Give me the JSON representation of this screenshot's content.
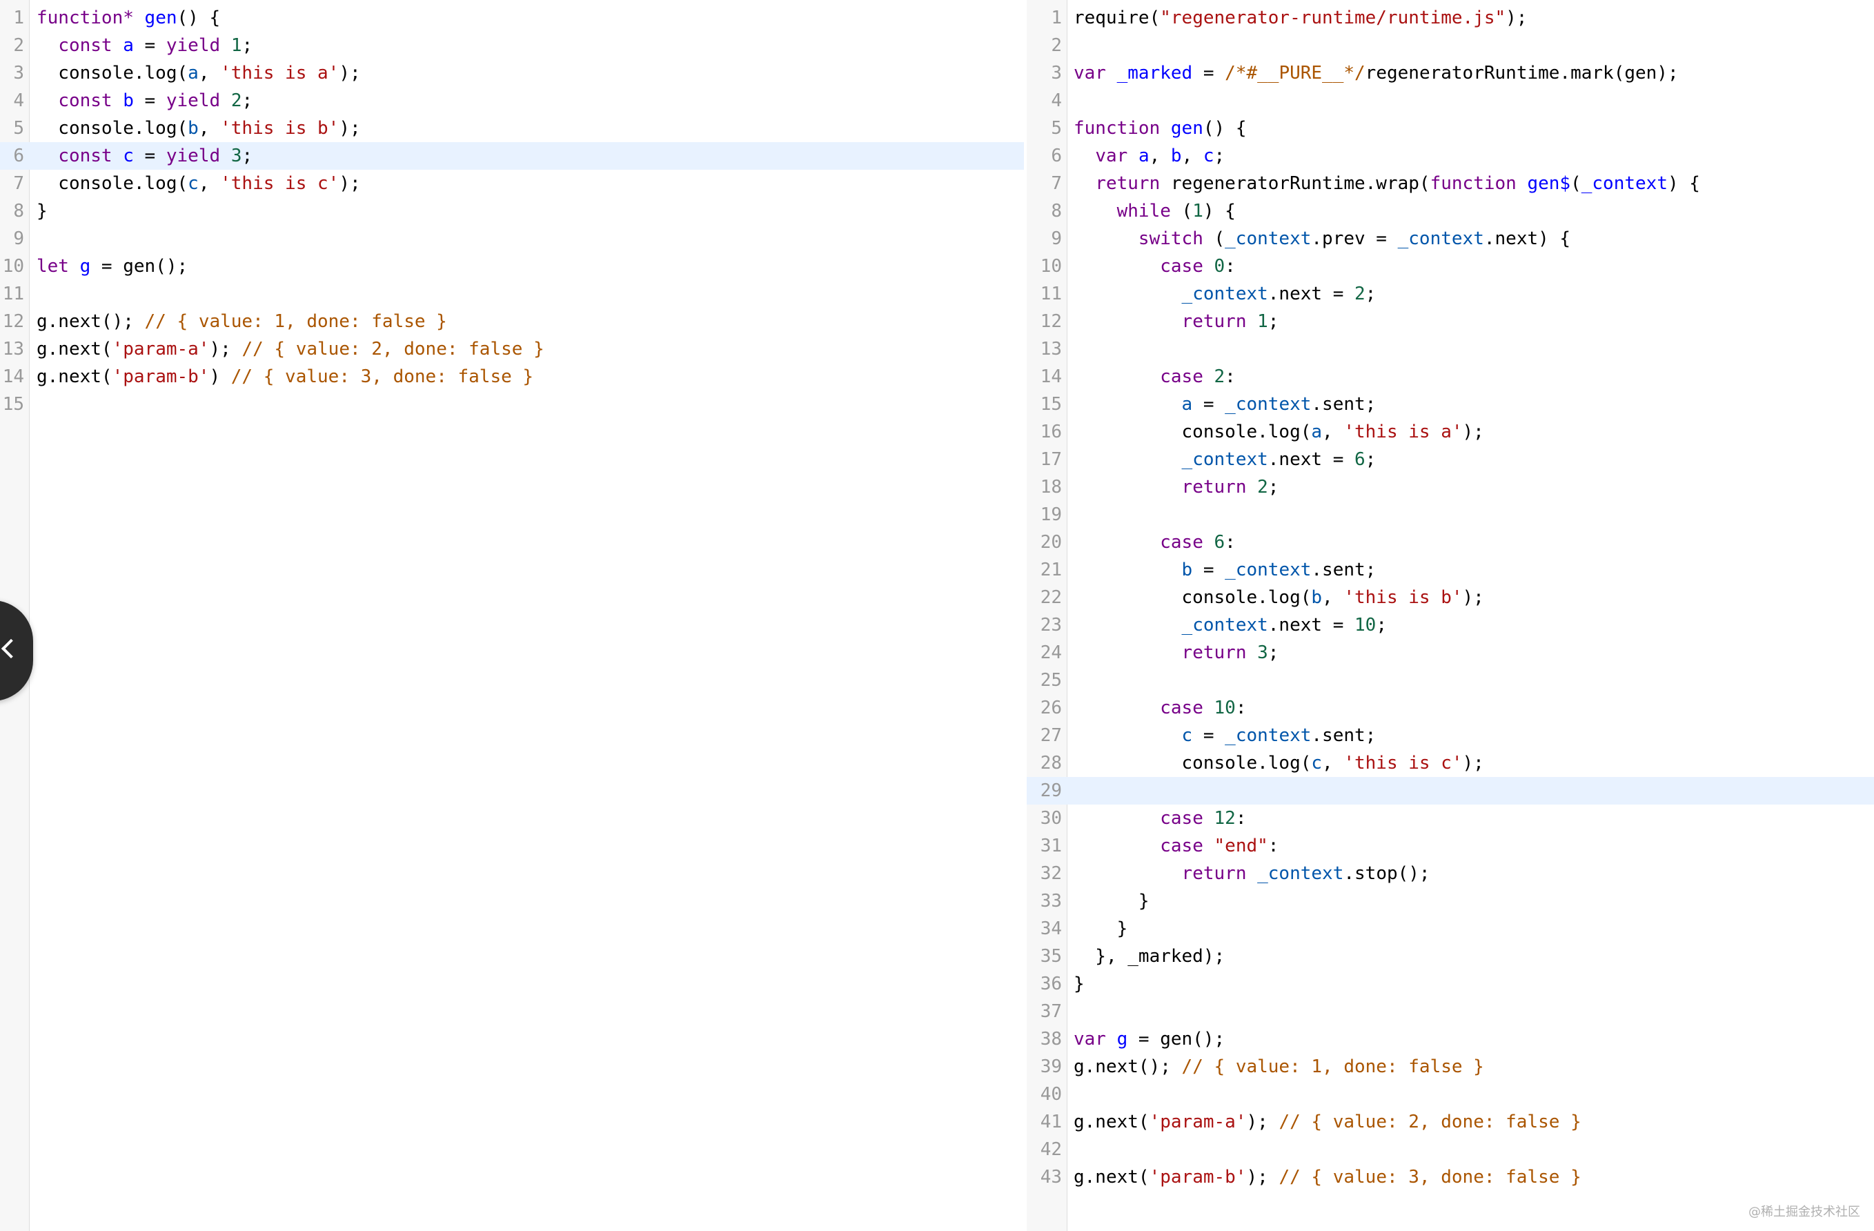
{
  "left_editor": {
    "active_line": 6,
    "lines": [
      [
        [
          "kw",
          "function"
        ],
        [
          "kw",
          "*"
        ],
        [
          "",
          " "
        ],
        [
          "def",
          "gen"
        ],
        [
          "",
          "() {"
        ]
      ],
      [
        [
          "",
          "  "
        ],
        [
          "kw",
          "const"
        ],
        [
          "",
          " "
        ],
        [
          "def",
          "a"
        ],
        [
          "",
          " = "
        ],
        [
          "kw",
          "yield"
        ],
        [
          "",
          " "
        ],
        [
          "num",
          "1"
        ],
        [
          "",
          ";"
        ]
      ],
      [
        [
          "",
          "  console.log("
        ],
        [
          "var",
          "a"
        ],
        [
          "",
          ", "
        ],
        [
          "str",
          "'this is a'"
        ],
        [
          "",
          ");"
        ]
      ],
      [
        [
          "",
          "  "
        ],
        [
          "kw",
          "const"
        ],
        [
          "",
          " "
        ],
        [
          "def",
          "b"
        ],
        [
          "",
          " = "
        ],
        [
          "kw",
          "yield"
        ],
        [
          "",
          " "
        ],
        [
          "num",
          "2"
        ],
        [
          "",
          ";"
        ]
      ],
      [
        [
          "",
          "  console.log("
        ],
        [
          "var",
          "b"
        ],
        [
          "",
          ", "
        ],
        [
          "str",
          "'this is b'"
        ],
        [
          "",
          ");"
        ]
      ],
      [
        [
          "",
          "  "
        ],
        [
          "kw",
          "const"
        ],
        [
          "",
          " "
        ],
        [
          "def",
          "c"
        ],
        [
          "",
          " = "
        ],
        [
          "kw",
          "yield"
        ],
        [
          "",
          " "
        ],
        [
          "num",
          "3"
        ],
        [
          "",
          ";"
        ]
      ],
      [
        [
          "",
          "  console.log("
        ],
        [
          "var",
          "c"
        ],
        [
          "",
          ", "
        ],
        [
          "str",
          "'this is c'"
        ],
        [
          "",
          ");"
        ]
      ],
      [
        [
          "",
          "}"
        ]
      ],
      [],
      [
        [
          "kw",
          "let"
        ],
        [
          "",
          " "
        ],
        [
          "def",
          "g"
        ],
        [
          "",
          " = gen();"
        ]
      ],
      [],
      [
        [
          "",
          "g.next(); "
        ],
        [
          "com",
          "// { value: 1, done: false }"
        ]
      ],
      [
        [
          "",
          "g.next("
        ],
        [
          "str",
          "'param-a'"
        ],
        [
          "",
          "); "
        ],
        [
          "com",
          "// { value: 2, done: false }"
        ]
      ],
      [
        [
          "",
          "g.next("
        ],
        [
          "str",
          "'param-b'"
        ],
        [
          "",
          ") "
        ],
        [
          "com",
          "// { value: 3, done: false }"
        ]
      ],
      []
    ]
  },
  "right_editor": {
    "active_line": 29,
    "lines": [
      [
        [
          "",
          "require("
        ],
        [
          "str",
          "\"regenerator-runtime/runtime.js\""
        ],
        [
          "",
          ");"
        ]
      ],
      [],
      [
        [
          "kw",
          "var"
        ],
        [
          "",
          " "
        ],
        [
          "def",
          "_marked"
        ],
        [
          "",
          " = "
        ],
        [
          "com",
          "/*#__PURE__*/"
        ],
        [
          "",
          "regeneratorRuntime.mark(gen);"
        ]
      ],
      [],
      [
        [
          "kw",
          "function"
        ],
        [
          "",
          " "
        ],
        [
          "def",
          "gen"
        ],
        [
          "",
          "() {"
        ]
      ],
      [
        [
          "",
          "  "
        ],
        [
          "kw",
          "var"
        ],
        [
          "",
          " "
        ],
        [
          "def",
          "a"
        ],
        [
          "",
          ", "
        ],
        [
          "def",
          "b"
        ],
        [
          "",
          ", "
        ],
        [
          "def",
          "c"
        ],
        [
          "",
          ";"
        ]
      ],
      [
        [
          "",
          "  "
        ],
        [
          "kw",
          "return"
        ],
        [
          "",
          " regeneratorRuntime.wrap("
        ],
        [
          "kw",
          "function"
        ],
        [
          "",
          " "
        ],
        [
          "def",
          "gen$"
        ],
        [
          "",
          "("
        ],
        [
          "def",
          "_context"
        ],
        [
          "",
          ") {"
        ]
      ],
      [
        [
          "",
          "    "
        ],
        [
          "kw",
          "while"
        ],
        [
          "",
          " ("
        ],
        [
          "num",
          "1"
        ],
        [
          "",
          ") {"
        ]
      ],
      [
        [
          "",
          "      "
        ],
        [
          "kw",
          "switch"
        ],
        [
          "",
          " ("
        ],
        [
          "var",
          "_context"
        ],
        [
          "",
          ".prev = "
        ],
        [
          "var",
          "_context"
        ],
        [
          "",
          ".next) {"
        ]
      ],
      [
        [
          "",
          "        "
        ],
        [
          "kw",
          "case"
        ],
        [
          "",
          " "
        ],
        [
          "num",
          "0"
        ],
        [
          "",
          ":"
        ]
      ],
      [
        [
          "",
          "          "
        ],
        [
          "var",
          "_context"
        ],
        [
          "",
          ".next = "
        ],
        [
          "num",
          "2"
        ],
        [
          "",
          ";"
        ]
      ],
      [
        [
          "",
          "          "
        ],
        [
          "kw",
          "return"
        ],
        [
          "",
          " "
        ],
        [
          "num",
          "1"
        ],
        [
          "",
          ";"
        ]
      ],
      [],
      [
        [
          "",
          "        "
        ],
        [
          "kw",
          "case"
        ],
        [
          "",
          " "
        ],
        [
          "num",
          "2"
        ],
        [
          "",
          ":"
        ]
      ],
      [
        [
          "",
          "          "
        ],
        [
          "var",
          "a"
        ],
        [
          "",
          " = "
        ],
        [
          "var",
          "_context"
        ],
        [
          "",
          ".sent;"
        ]
      ],
      [
        [
          "",
          "          console.log("
        ],
        [
          "var",
          "a"
        ],
        [
          "",
          ", "
        ],
        [
          "str",
          "'this is a'"
        ],
        [
          "",
          ");"
        ]
      ],
      [
        [
          "",
          "          "
        ],
        [
          "var",
          "_context"
        ],
        [
          "",
          ".next = "
        ],
        [
          "num",
          "6"
        ],
        [
          "",
          ";"
        ]
      ],
      [
        [
          "",
          "          "
        ],
        [
          "kw",
          "return"
        ],
        [
          "",
          " "
        ],
        [
          "num",
          "2"
        ],
        [
          "",
          ";"
        ]
      ],
      [],
      [
        [
          "",
          "        "
        ],
        [
          "kw",
          "case"
        ],
        [
          "",
          " "
        ],
        [
          "num",
          "6"
        ],
        [
          "",
          ":"
        ]
      ],
      [
        [
          "",
          "          "
        ],
        [
          "var",
          "b"
        ],
        [
          "",
          " = "
        ],
        [
          "var",
          "_context"
        ],
        [
          "",
          ".sent;"
        ]
      ],
      [
        [
          "",
          "          console.log("
        ],
        [
          "var",
          "b"
        ],
        [
          "",
          ", "
        ],
        [
          "str",
          "'this is b'"
        ],
        [
          "",
          ");"
        ]
      ],
      [
        [
          "",
          "          "
        ],
        [
          "var",
          "_context"
        ],
        [
          "",
          ".next = "
        ],
        [
          "num",
          "10"
        ],
        [
          "",
          ";"
        ]
      ],
      [
        [
          "",
          "          "
        ],
        [
          "kw",
          "return"
        ],
        [
          "",
          " "
        ],
        [
          "num",
          "3"
        ],
        [
          "",
          ";"
        ]
      ],
      [],
      [
        [
          "",
          "        "
        ],
        [
          "kw",
          "case"
        ],
        [
          "",
          " "
        ],
        [
          "num",
          "10"
        ],
        [
          "",
          ":"
        ]
      ],
      [
        [
          "",
          "          "
        ],
        [
          "var",
          "c"
        ],
        [
          "",
          " = "
        ],
        [
          "var",
          "_context"
        ],
        [
          "",
          ".sent;"
        ]
      ],
      [
        [
          "",
          "          console.log("
        ],
        [
          "var",
          "c"
        ],
        [
          "",
          ", "
        ],
        [
          "str",
          "'this is c'"
        ],
        [
          "",
          ");"
        ]
      ],
      [],
      [
        [
          "",
          "        "
        ],
        [
          "kw",
          "case"
        ],
        [
          "",
          " "
        ],
        [
          "num",
          "12"
        ],
        [
          "",
          ":"
        ]
      ],
      [
        [
          "",
          "        "
        ],
        [
          "kw",
          "case"
        ],
        [
          "",
          " "
        ],
        [
          "str",
          "\"end\""
        ],
        [
          "",
          ":"
        ]
      ],
      [
        [
          "",
          "          "
        ],
        [
          "kw",
          "return"
        ],
        [
          "",
          " "
        ],
        [
          "var",
          "_context"
        ],
        [
          "",
          ".stop();"
        ]
      ],
      [
        [
          "",
          "      }"
        ]
      ],
      [
        [
          "",
          "    }"
        ]
      ],
      [
        [
          "",
          "  }, _marked);"
        ]
      ],
      [
        [
          "",
          "}"
        ]
      ],
      [],
      [
        [
          "kw",
          "var"
        ],
        [
          "",
          " "
        ],
        [
          "def",
          "g"
        ],
        [
          "",
          " = gen();"
        ]
      ],
      [
        [
          "",
          "g.next(); "
        ],
        [
          "com",
          "// { value: 1, done: false }"
        ]
      ],
      [],
      [
        [
          "",
          "g.next("
        ],
        [
          "str",
          "'param-a'"
        ],
        [
          "",
          "); "
        ],
        [
          "com",
          "// { value: 2, done: false }"
        ]
      ],
      [],
      [
        [
          "",
          "g.next("
        ],
        [
          "str",
          "'param-b'"
        ],
        [
          "",
          "); "
        ],
        [
          "com",
          "// { value: 3, done: false }"
        ]
      ]
    ]
  },
  "watermark": "@稀土掘金技术社区",
  "icons": {
    "collapse": "chevron-left-icon"
  },
  "colors": {
    "keyword": "#770088",
    "definition": "#0000ff",
    "variable": "#0055aa",
    "number": "#116644",
    "string": "#aa1111",
    "comment": "#aa5500",
    "active_line": "#e8f2ff",
    "gutter": "#f7f7f7"
  }
}
